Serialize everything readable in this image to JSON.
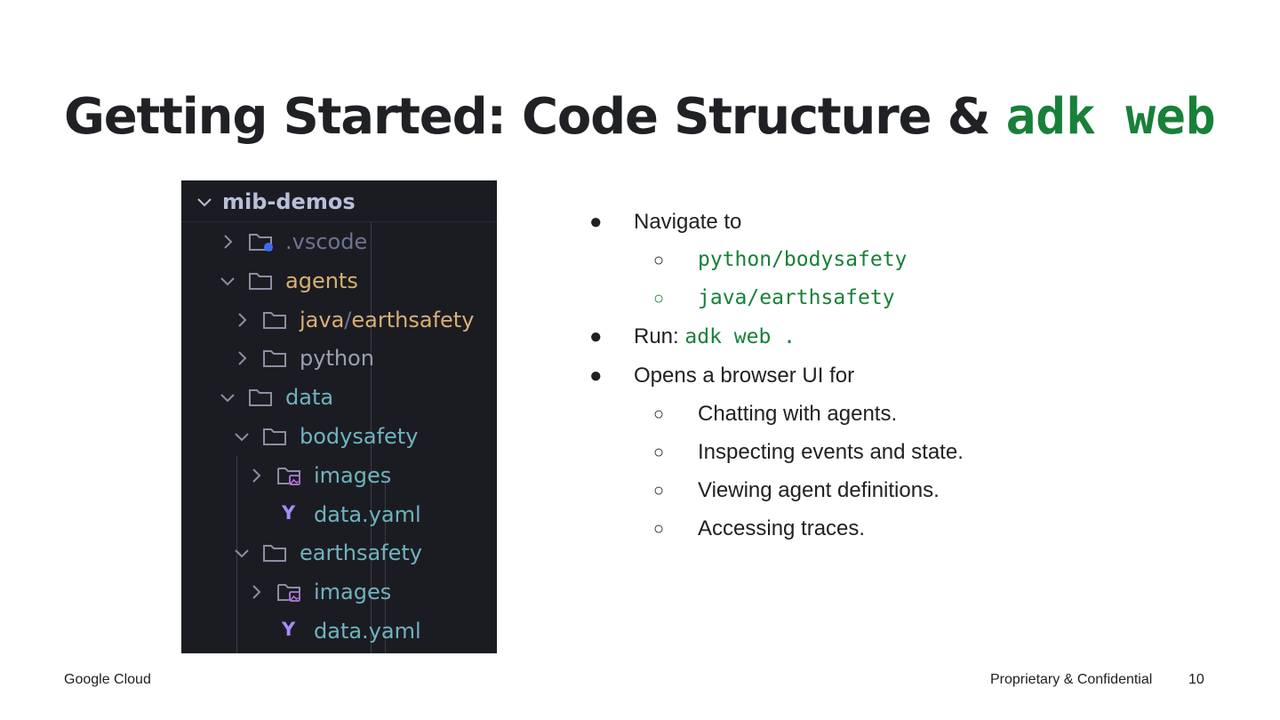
{
  "slide": {
    "title_text": "Getting Started: Code Structure & ",
    "title_code": "adk web"
  },
  "explorer": {
    "root": "mib-demos",
    "items": [
      {
        "label": ".vscode",
        "icon": "folder-modified-icon",
        "chevron": "collapsed"
      },
      {
        "label": "agents",
        "icon": "folder-icon",
        "chevron": "expanded"
      },
      {
        "label_parts": [
          "java",
          "/",
          "earthsafety"
        ],
        "icon": "folder-icon",
        "chevron": "collapsed"
      },
      {
        "label": "python",
        "icon": "folder-icon",
        "chevron": "collapsed"
      },
      {
        "label": "data",
        "icon": "folder-icon",
        "chevron": "expanded"
      },
      {
        "label": "bodysafety",
        "icon": "folder-icon",
        "chevron": "expanded"
      },
      {
        "label": "images",
        "icon": "folder-images-icon",
        "chevron": "collapsed"
      },
      {
        "label": "data.yaml",
        "icon": "yaml-file-icon",
        "glyph": "Y"
      },
      {
        "label": "earthsafety",
        "icon": "folder-icon",
        "chevron": "expanded"
      },
      {
        "label": "images",
        "icon": "folder-images-icon",
        "chevron": "collapsed"
      },
      {
        "label": "data.yaml",
        "icon": "yaml-file-icon",
        "glyph": "Y"
      }
    ]
  },
  "bullets": {
    "bullet_glyph": "●",
    "sub_glyph": "○",
    "navigate": "Navigate to",
    "path_python": "python/bodysafety",
    "path_java": "java/earthsafety",
    "run_label": "Run: ",
    "run_cmd": "adk web .",
    "opens": "Opens a browser UI for",
    "subs": [
      "Chatting with agents.",
      "Inspecting events and state.",
      "Viewing agent definitions.",
      "Accessing traces."
    ]
  },
  "footer": {
    "brand": "Google Cloud",
    "confidential": "Proprietary & Confidential",
    "page": "10"
  },
  "colors": {
    "accent_green": "#188038",
    "explorer_bg": "#1b1c22",
    "teal": "#6fb3bf",
    "gold": "#d8b073",
    "purple": "#a78bfa"
  }
}
